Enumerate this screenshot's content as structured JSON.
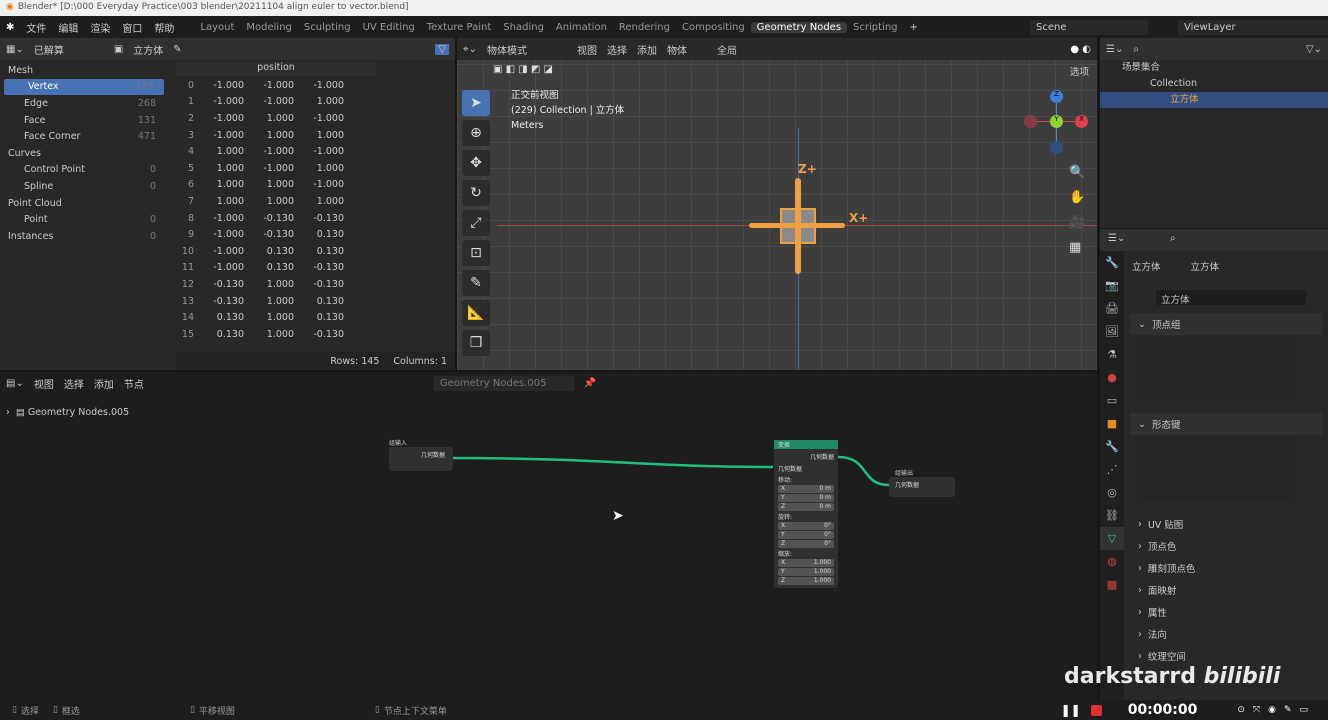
{
  "window_title": "Blender* [D:\\000 Everyday Practice\\003 blender\\20211104 align euler to vector.blend]",
  "menu": [
    "文件",
    "编辑",
    "渲染",
    "窗口",
    "帮助"
  ],
  "workspaces": [
    "Layout",
    "Modeling",
    "Sculpting",
    "UV Editing",
    "Texture Paint",
    "Shading",
    "Animation",
    "Rendering",
    "Compositing",
    "Geometry Nodes",
    "Scripting"
  ],
  "active_workspace": "Geometry Nodes",
  "scene": "Scene",
  "view_layer": "ViewLayer",
  "spreadsheet": {
    "mode": "已解算",
    "object": "立方体",
    "column_header": "position",
    "tree": [
      {
        "label": "Mesh",
        "group": true
      },
      {
        "label": "Vertex",
        "count": "145",
        "selected": true
      },
      {
        "label": "Edge",
        "count": "268"
      },
      {
        "label": "Face",
        "count": "131"
      },
      {
        "label": "Face Corner",
        "count": "471"
      },
      {
        "label": "Curves",
        "group": true
      },
      {
        "label": "Control Point",
        "count": "0"
      },
      {
        "label": "Spline",
        "count": "0"
      },
      {
        "label": "Point Cloud",
        "group": true
      },
      {
        "label": "Point",
        "count": "0"
      },
      {
        "label": "Instances",
        "count": "0",
        "group": true
      }
    ],
    "rows": [
      [
        "0",
        "-1.000",
        "-1.000",
        "-1.000"
      ],
      [
        "1",
        "-1.000",
        "-1.000",
        "1.000"
      ],
      [
        "2",
        "-1.000",
        "1.000",
        "-1.000"
      ],
      [
        "3",
        "-1.000",
        "1.000",
        "1.000"
      ],
      [
        "4",
        "1.000",
        "-1.000",
        "-1.000"
      ],
      [
        "5",
        "1.000",
        "-1.000",
        "1.000"
      ],
      [
        "6",
        "1.000",
        "1.000",
        "-1.000"
      ],
      [
        "7",
        "1.000",
        "1.000",
        "1.000"
      ],
      [
        "8",
        "-1.000",
        "-0.130",
        "-0.130"
      ],
      [
        "9",
        "-1.000",
        "-0.130",
        "0.130"
      ],
      [
        "10",
        "-1.000",
        "0.130",
        "0.130"
      ],
      [
        "11",
        "-1.000",
        "0.130",
        "-0.130"
      ],
      [
        "12",
        "-0.130",
        "1.000",
        "-0.130"
      ],
      [
        "13",
        "-0.130",
        "1.000",
        "0.130"
      ],
      [
        "14",
        "0.130",
        "1.000",
        "0.130"
      ],
      [
        "15",
        "0.130",
        "1.000",
        "-0.130"
      ]
    ],
    "rows_label": "Rows: 145",
    "columns_label": "Columns: 1"
  },
  "viewport": {
    "mode": "物体模式",
    "menus": [
      "视图",
      "选择",
      "添加",
      "物体"
    ],
    "orientation": "全局",
    "options": "选项",
    "view_name": "正交前视图",
    "collection_info": "(229) Collection | 立方体",
    "units": "Meters",
    "axis_z": "Z+",
    "axis_x": "X+",
    "gizmo": {
      "z": "Z",
      "y": "Y",
      "x": "X"
    }
  },
  "outliner": {
    "items": [
      {
        "label": "场景集合"
      },
      {
        "label": "Collection"
      },
      {
        "label": "立方体",
        "selected": true
      }
    ]
  },
  "properties": {
    "object": "立方体",
    "data": "立方体",
    "mesh_name": "立方体",
    "sections": [
      "顶点组",
      "形态键",
      "UV 贴图",
      "顶点色",
      "雕刻顶点色",
      "面映射",
      "属性",
      "法向",
      "纹理空间"
    ]
  },
  "node_editor": {
    "menus": [
      "视图",
      "选择",
      "添加",
      "节点"
    ],
    "tree_name": "Geometry Nodes.005",
    "breadcrumb": "Geometry Nodes.005",
    "group_input": {
      "title": "组输入",
      "socket": "几何数据"
    },
    "transform": {
      "title": "变换",
      "out": "几何数据",
      "in": "几何数据",
      "translate": "移动:",
      "rotate": "旋转:",
      "scale": "缩放:",
      "t": [
        [
          "X",
          "0 m"
        ],
        [
          "Y",
          "0 m"
        ],
        [
          "Z",
          "0 m"
        ]
      ],
      "r": [
        [
          "X",
          "0°"
        ],
        [
          "Y",
          "0°"
        ],
        [
          "Z",
          "0°"
        ]
      ],
      "s": [
        [
          "X",
          "1.000"
        ],
        [
          "Y",
          "1.000"
        ],
        [
          "Z",
          "1.000"
        ]
      ]
    },
    "group_output": {
      "title": "组输出",
      "socket": "几何数据"
    },
    "link_color": "#1fbf7f",
    "node_header_color": "#1f8a63"
  },
  "status": {
    "select": "选择",
    "box": "框选",
    "pan": "平移视图",
    "context": "节点上下文菜单",
    "timer": "00:00:00"
  },
  "watermark": "darkstarrd bilibili"
}
